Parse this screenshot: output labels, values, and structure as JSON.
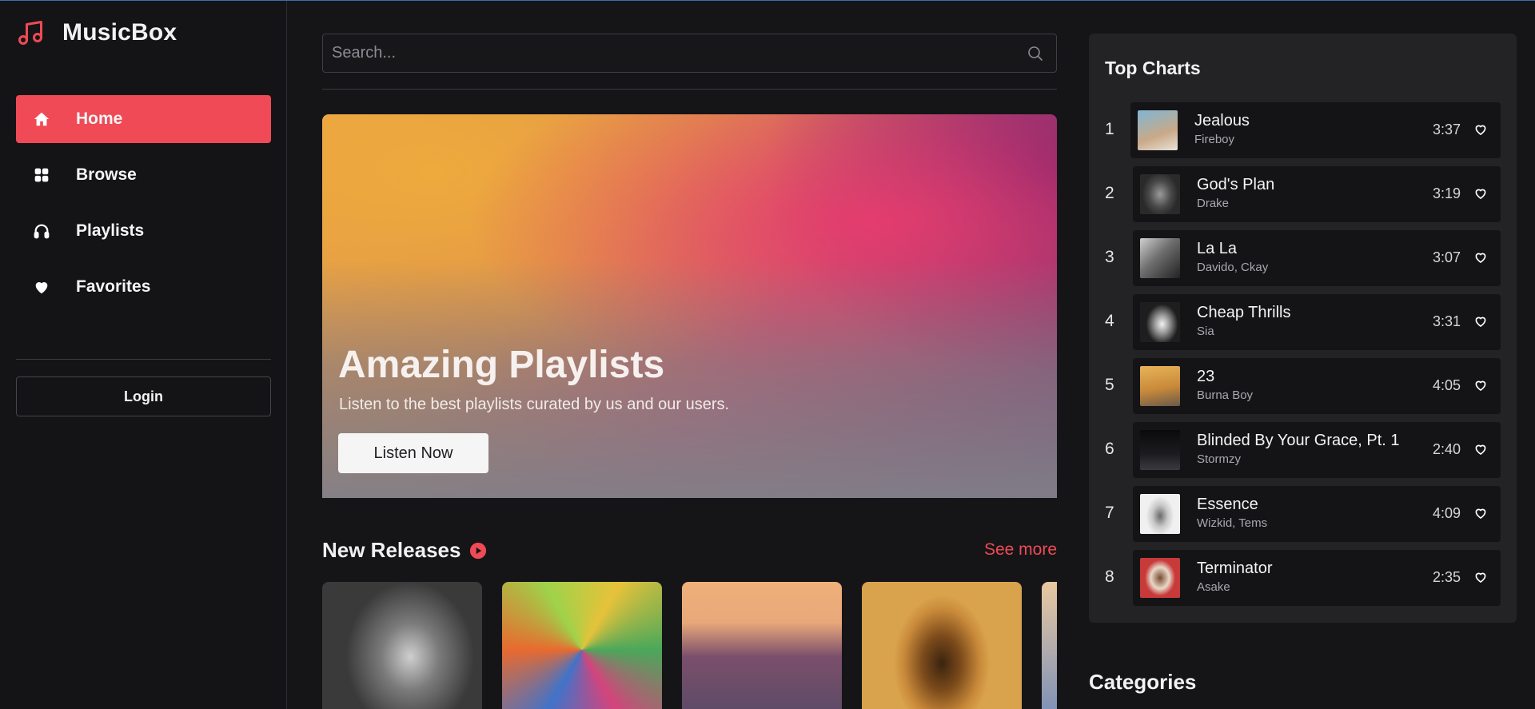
{
  "brand": {
    "name": "MusicBox",
    "icon": "music-note-icon",
    "accent": "#ef4a55"
  },
  "nav": {
    "items": [
      {
        "label": "Home",
        "icon": "home-icon",
        "active": true
      },
      {
        "label": "Browse",
        "icon": "grid-icon",
        "active": false
      },
      {
        "label": "Playlists",
        "icon": "headphones-icon",
        "active": false
      },
      {
        "label": "Favorites",
        "icon": "heart-icon",
        "active": false
      }
    ],
    "login_label": "Login"
  },
  "search": {
    "placeholder": "Search...",
    "value": ""
  },
  "hero": {
    "title": "Amazing Playlists",
    "subtitle": "Listen to the best playlists curated by us and our users.",
    "button_label": "Listen Now"
  },
  "new_releases": {
    "title": "New Releases",
    "see_more_label": "See more"
  },
  "top_charts": {
    "title": "Top Charts",
    "tracks": [
      {
        "rank": "1",
        "title": "Jealous",
        "artist": "Fireboy",
        "duration": "3:37"
      },
      {
        "rank": "2",
        "title": "God's Plan",
        "artist": "Drake",
        "duration": "3:19"
      },
      {
        "rank": "3",
        "title": "La La",
        "artist": "Davido, Ckay",
        "duration": "3:07"
      },
      {
        "rank": "4",
        "title": "Cheap Thrills",
        "artist": "Sia",
        "duration": "3:31"
      },
      {
        "rank": "5",
        "title": "23",
        "artist": "Burna Boy",
        "duration": "4:05"
      },
      {
        "rank": "6",
        "title": "Blinded By Your Grace, Pt. 1",
        "artist": "Stormzy",
        "duration": "2:40"
      },
      {
        "rank": "7",
        "title": "Essence",
        "artist": "Wizkid, Tems",
        "duration": "4:09"
      },
      {
        "rank": "8",
        "title": "Terminator",
        "artist": "Asake",
        "duration": "2:35"
      }
    ]
  },
  "categories": {
    "title": "Categories"
  }
}
